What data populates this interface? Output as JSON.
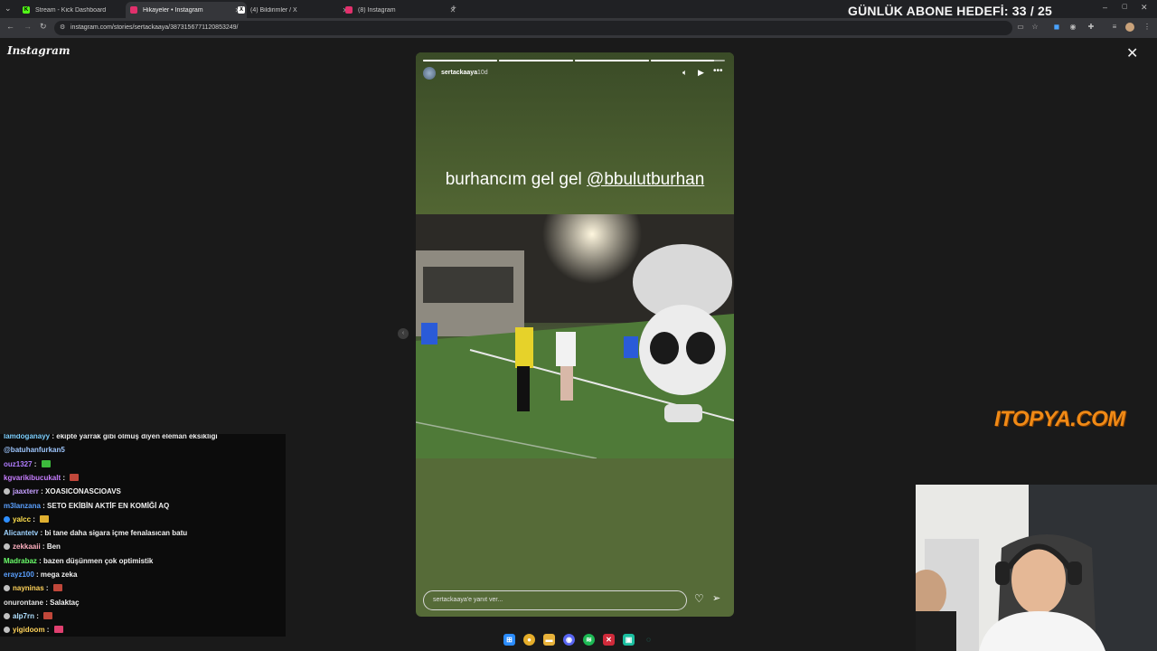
{
  "browser": {
    "tabs": [
      {
        "label": "Stream - Kick Dashboard",
        "favicon": "kick-icon",
        "color": "#53fc18",
        "glyph": "K",
        "active": false
      },
      {
        "label": "Hikayeler • Instagram",
        "favicon": "instagram-icon",
        "color": "#e1306c",
        "glyph": "",
        "active": true
      },
      {
        "label": "(4) Bildirimler / X",
        "favicon": "x-icon",
        "color": "#ffffff",
        "glyph": "X",
        "active": false
      },
      {
        "label": "(8) Instagram",
        "favicon": "instagram-icon",
        "color": "#e1306c",
        "glyph": "",
        "active": false
      }
    ],
    "url": "instagram.com/stories/sertackaaya/3873156771120853249/"
  },
  "overlay": {
    "goal_text": "GÜNLÜK ABONE HEDEFİ: 33 / 25",
    "sponsor_logo": "ITOPYA.COM"
  },
  "instagram": {
    "logo": "Instagram",
    "story": {
      "username": "sertackaaya",
      "age": "10d",
      "caption_text": "burhancım gel gel ",
      "caption_mention": "@bbulutburhan",
      "progress": [
        1,
        1,
        1,
        0.85
      ],
      "reply_placeholder": "sertackaaya'e yanıt ver..."
    }
  },
  "chat": {
    "messages": [
      {
        "user": "lamdoganayy",
        "text": "ekipte yarrak gibi olmuş diyen eleman eksikliği",
        "color": "#7fd1ff"
      },
      {
        "user": "",
        "text": "@batuhanfurkan5",
        "color": "#9ec7ff"
      },
      {
        "user": "ouz1327",
        "text": "",
        "color": "#b07cff",
        "emote": "#3dbb3d"
      },
      {
        "user": "kgvarikibucukalt",
        "text": "",
        "color": "#c77dff",
        "emote": "#c0473a"
      },
      {
        "user": "jaaxterr",
        "text": "XOASICONASCIOAVS",
        "color": "#c6a0ff",
        "badge": "#c0c0c0"
      },
      {
        "user": "m3lanzana",
        "text": "SETO EKİBİN AKTİF EN KOMİĞİ AQ",
        "color": "#5aa0ff"
      },
      {
        "user": "yalcc",
        "text": "",
        "color": "#ffe04d",
        "badge": "#2e8fff",
        "emote": "#e0b030"
      },
      {
        "user": "Alicantetv",
        "text": "bi tane daha sigara içme fenalasıcan batu",
        "color": "#9fd3ff"
      },
      {
        "user": "zekkaaii",
        "text": "Ben",
        "color": "#ffb0c0",
        "badge": "#c0c0c0"
      },
      {
        "user": "Madrabaz",
        "text": "bazen düşünmen çok optimistik",
        "color": "#6bff6b"
      },
      {
        "user": "erayz100",
        "text": "mega zeka",
        "color": "#5aa0ff"
      },
      {
        "user": "nayninas",
        "text": "",
        "color": "#ffd35a",
        "badge": "#c0c0c0",
        "emote": "#c0473a"
      },
      {
        "user": "onurontane",
        "text": "Salaktaç",
        "color": "#e0e0e0"
      },
      {
        "user": "alp7rn",
        "text": "",
        "color": "#b0e0ff",
        "badge": "#c0c0c0",
        "emote": "#c0473a"
      },
      {
        "user": "yigidoom",
        "text": "",
        "color": "#ffd35a",
        "badge": "#c0c0c0",
        "emote": "#e04070"
      }
    ]
  },
  "icons": {
    "close": "close-icon",
    "mute": "volume-icon",
    "play": "play-icon",
    "more": "more-icon",
    "like": "heart-icon",
    "share": "send-icon"
  }
}
